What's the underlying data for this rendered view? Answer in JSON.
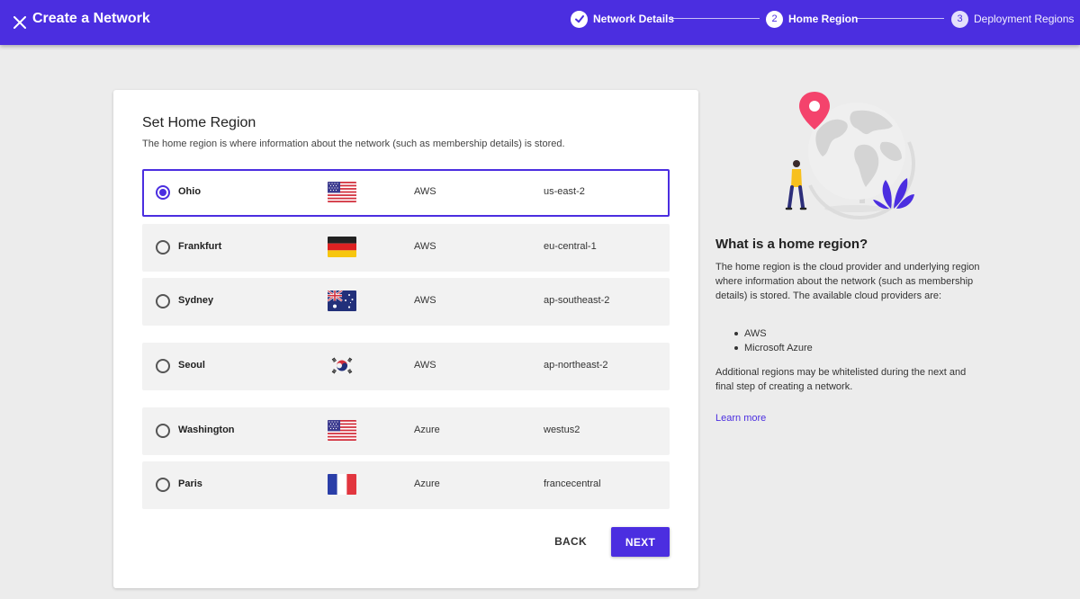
{
  "header": {
    "title": "Create a Network",
    "steps": [
      {
        "number": "1",
        "label": "Network Details",
        "status": "complete"
      },
      {
        "number": "2",
        "label": "Home Region",
        "status": "active"
      },
      {
        "number": "3",
        "label": "Deployment Regions",
        "status": "pending"
      }
    ]
  },
  "main": {
    "title": "Set Home Region",
    "subtitle": "The home region is where information about the network (such as membership details) is stored.",
    "regions": [
      {
        "city": "Ohio",
        "flag": "us-flag-icon",
        "provider": "AWS",
        "code": "us-east-2",
        "selected": true
      },
      {
        "city": "Frankfurt",
        "flag": "germany-flag-icon",
        "provider": "AWS",
        "code": "eu-central-1",
        "selected": false
      },
      {
        "city": "Sydney",
        "flag": "australia-flag-icon",
        "provider": "AWS",
        "code": "ap-southeast-2",
        "selected": false
      },
      {
        "city": "Seoul",
        "flag": "south-korea-flag-icon",
        "provider": "AWS",
        "code": "ap-northeast-2",
        "selected": false
      },
      {
        "city": "Washington",
        "flag": "us-flag-icon",
        "provider": "Azure",
        "code": "westus2",
        "selected": false
      },
      {
        "city": "Paris",
        "flag": "france-flag-icon",
        "provider": "Azure",
        "code": "francecentral",
        "selected": false
      }
    ],
    "back_label": "BACK",
    "next_label": "NEXT"
  },
  "info": {
    "title": "What is a home region?",
    "body": "The home region is the cloud provider and underlying region where information about the network (such as membership details) is stored. The available cloud providers are:",
    "providers": [
      "AWS",
      "Microsoft Azure"
    ],
    "extra": "Additional regions may be whitelisted during the next and final step of creating a network.",
    "learn_more": "Learn more"
  },
  "colors": {
    "accent": "#4b2ee0",
    "header_bg": "#4b2ee0",
    "page_bg": "#ececec",
    "row_bg": "#f2f2f2"
  }
}
